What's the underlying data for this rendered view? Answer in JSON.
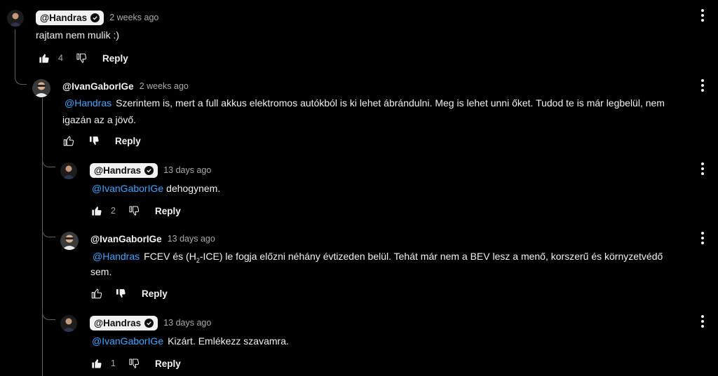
{
  "comments": [
    {
      "author": "@Handras",
      "verified": true,
      "time": "2 weeks ago",
      "text": "rajtam nem mulik :)",
      "likes": "4",
      "liked": true,
      "reply": "Reply"
    },
    {
      "author": "@IvanGaborIGe",
      "verified": false,
      "time": "2 weeks ago",
      "mention": "@Handras",
      "text_line1": "Szerintem is, mert a full akkus elektromos autókból is ki lehet ábrándulni. Meg is lehet unni őket. Tudod te is már legbelül, nem",
      "text_line2": "igazán az a jövő.",
      "likes": "",
      "liked": false,
      "disliked": true,
      "reply": "Reply"
    },
    {
      "author": "@Handras",
      "verified": true,
      "time": "13 days ago",
      "mention": "@IvanGaborIGe",
      "text": "dehogynem.",
      "likes": "2",
      "liked": true,
      "reply": "Reply"
    },
    {
      "author": "@IvanGaborIGe",
      "verified": false,
      "time": "13 days ago",
      "mention": "@Handras",
      "text_pre": "FCEV és (H",
      "sub": "2",
      "text_post": "-ICE) le fogja előzni néhány évtizeden belül. Tehát már nem a BEV lesz a menő, korszerű és környzetvédő",
      "text_line2": "sem.",
      "likes": "",
      "liked": false,
      "disliked": true,
      "reply": "Reply"
    },
    {
      "author": "@Handras",
      "verified": true,
      "time": "13 days ago",
      "mention": "@IvanGaborIGe",
      "text": "Kizárt. Emlékezz szavamra.",
      "likes": "1",
      "liked": true,
      "reply": "Reply"
    }
  ],
  "icons": {
    "like": "thumb-up-icon",
    "dislike": "thumb-down-icon",
    "menu": "more-vert-icon",
    "verified": "verified-check-icon"
  }
}
